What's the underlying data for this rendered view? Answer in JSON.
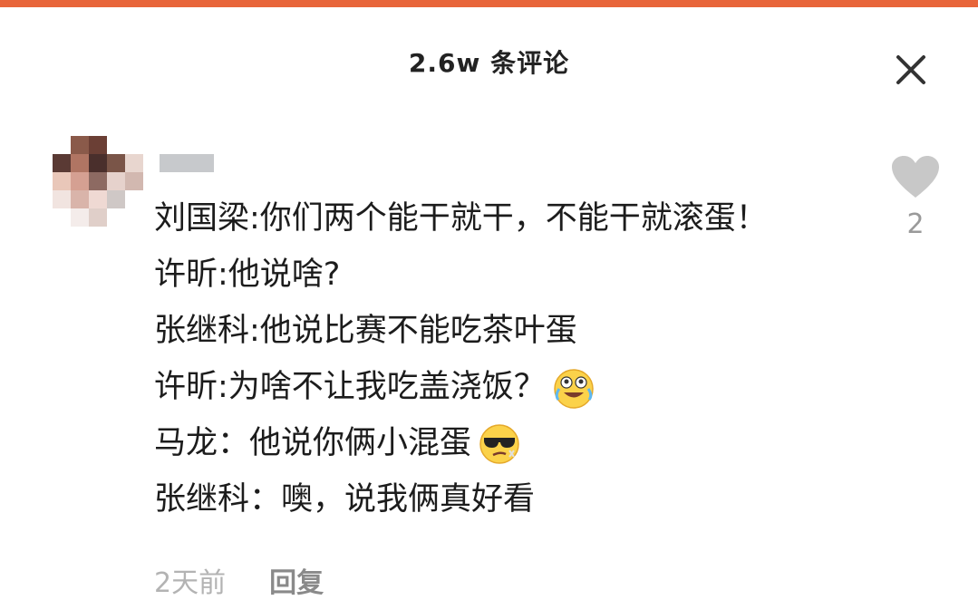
{
  "header": {
    "title": "2.6w 条评论"
  },
  "colors": {
    "accent": "#e8653a",
    "like_icon": "#c8c8c8",
    "text": "#1c1c1c",
    "muted": "#b3b3b3"
  },
  "comment": {
    "lines": [
      "刘国梁:你们两个能干就干，不能干就滚蛋！",
      "许昕:他说啥?",
      "张继科:他说比赛不能吃茶叶蛋",
      "许昕:为啥不让我吃盖浇饭？",
      "马龙：他说你俩小混蛋",
      "张继科：噢，说我俩真好看"
    ],
    "time": "2天前",
    "reply_label": "回复",
    "like_count": "2",
    "emoji": [
      "laughing-crying-emoji",
      "sunglasses-emoji"
    ]
  }
}
